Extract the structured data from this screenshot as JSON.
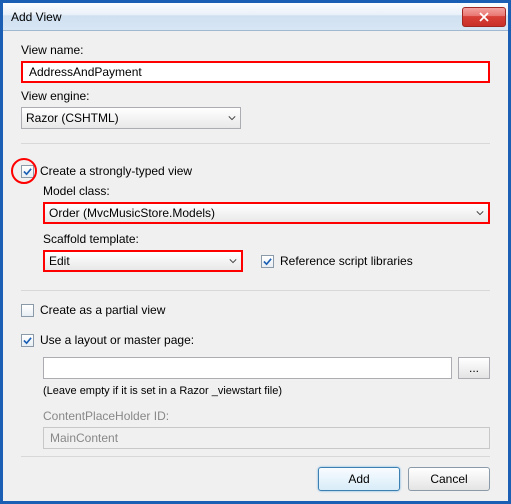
{
  "window": {
    "title": "Add View"
  },
  "viewName": {
    "label": "View name:",
    "value": "AddressAndPayment"
  },
  "viewEngine": {
    "label": "View engine:",
    "value": "Razor (CSHTML)"
  },
  "stronglyTyped": {
    "label": "Create a strongly-typed view",
    "checked": true
  },
  "modelClass": {
    "label": "Model class:",
    "value": "Order (MvcMusicStore.Models)"
  },
  "scaffold": {
    "label": "Scaffold template:",
    "value": "Edit"
  },
  "refScripts": {
    "label": "Reference script libraries",
    "checked": true
  },
  "partial": {
    "label": "Create as a partial view",
    "checked": false
  },
  "useLayout": {
    "label": "Use a layout or master page:",
    "checked": true
  },
  "layoutPath": {
    "value": ""
  },
  "layoutHint": "(Leave empty if it is set in a Razor _viewstart file)",
  "cph": {
    "label": "ContentPlaceHolder ID:",
    "value": "MainContent"
  },
  "browse": "...",
  "buttons": {
    "add": "Add",
    "cancel": "Cancel"
  }
}
